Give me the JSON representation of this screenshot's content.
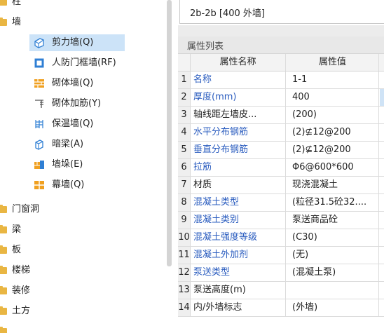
{
  "tree": {
    "categories_top": [
      {
        "label": "柱",
        "icon": "folder-icon"
      },
      {
        "label": "墙",
        "icon": "folder-icon"
      }
    ],
    "wall_items": [
      {
        "label": "剪力墙(Q)",
        "icon": "shear-wall-icon",
        "selected": true
      },
      {
        "label": "人防门框墙(RF)",
        "icon": "civil-defense-door-wall-icon",
        "selected": false
      },
      {
        "label": "砌体墙(Q)",
        "icon": "masonry-wall-icon",
        "selected": false
      },
      {
        "label": "砌体加筋(Y)",
        "icon": "masonry-reinforcement-icon",
        "selected": false
      },
      {
        "label": "保温墙(Q)",
        "icon": "insulation-wall-icon",
        "selected": false
      },
      {
        "label": "暗梁(A)",
        "icon": "hidden-beam-icon",
        "selected": false
      },
      {
        "label": "墙垛(E)",
        "icon": "wall-pier-icon",
        "selected": false
      },
      {
        "label": "幕墙(Q)",
        "icon": "curtain-wall-icon",
        "selected": false
      }
    ],
    "categories_bottom": [
      {
        "label": "门窗洞",
        "icon": "folder-icon"
      },
      {
        "label": "梁",
        "icon": "folder-icon"
      },
      {
        "label": "板",
        "icon": "folder-icon"
      },
      {
        "label": "楼梯",
        "icon": "folder-icon"
      },
      {
        "label": "装修",
        "icon": "folder-icon"
      },
      {
        "label": "土方",
        "icon": "folder-icon"
      }
    ],
    "colors": {
      "selected_bg": "#cce3f8",
      "folder": "#e9b643",
      "icon_blue": "#2f7fd4",
      "icon_orange": "#f0a020"
    }
  },
  "wall_list": {
    "partial_item": "2b-2b [400 外墙]"
  },
  "properties": {
    "title": "属性列表",
    "columns": {
      "name": "属性名称",
      "value": "属性值"
    },
    "rows": [
      {
        "no": "1",
        "name": "名称",
        "value": "1-1",
        "name_color": "blue"
      },
      {
        "no": "2",
        "name": "厚度(mm)",
        "value": "400",
        "name_color": "blue",
        "highlight_extra": true
      },
      {
        "no": "3",
        "name": "轴线距左墙皮...",
        "value": "(200)",
        "name_color": "black"
      },
      {
        "no": "4",
        "name": "水平分布钢筋",
        "value": "(2)⊈12@200",
        "name_color": "blue"
      },
      {
        "no": "5",
        "name": "垂直分布钢筋",
        "value": "(2)⊈12@200",
        "name_color": "blue"
      },
      {
        "no": "6",
        "name": "拉筋",
        "value": "Φ6@600*600",
        "name_color": "blue"
      },
      {
        "no": "7",
        "name": "材质",
        "value": "现浇混凝土",
        "name_color": "black"
      },
      {
        "no": "8",
        "name": "混凝土类型",
        "value": "(粒径31.5砼32....",
        "name_color": "blue"
      },
      {
        "no": "9",
        "name": "混凝土类别",
        "value": "泵送商品砼",
        "name_color": "blue"
      },
      {
        "no": "10",
        "name": "混凝土强度等级",
        "value": "(C30)",
        "name_color": "blue"
      },
      {
        "no": "11",
        "name": "混凝土外加剂",
        "value": "(无)",
        "name_color": "blue"
      },
      {
        "no": "12",
        "name": "泵送类型",
        "value": "(混凝土泵)",
        "name_color": "blue"
      },
      {
        "no": "13",
        "name": "泵送高度(m)",
        "value": "",
        "name_color": "black"
      },
      {
        "no": "14",
        "name": "内/外墙标志",
        "value": "(外墙)",
        "name_color": "black"
      }
    ],
    "colors": {
      "blue_name": "#2a5cbf",
      "header_bg": "#e8e8e8"
    }
  }
}
